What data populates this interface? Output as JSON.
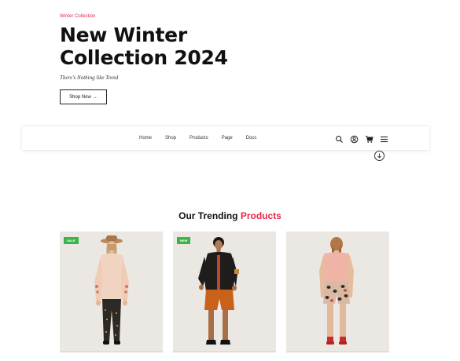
{
  "hero": {
    "eyebrow": "Winter Collection",
    "title_line1": "New Winter",
    "title_line2": "Collection 2024",
    "tagline": "There's Nothing like Trend",
    "cta_label": "Shop Now",
    "cta_arrow": "→"
  },
  "nav": {
    "links": [
      "Home",
      "Shop",
      "Products",
      "Page",
      "Docs"
    ],
    "icons": [
      "search-icon",
      "user-icon",
      "cart-icon",
      "menu-icon"
    ]
  },
  "section": {
    "title_prefix": "Our Trending",
    "title_accent": "Products"
  },
  "products": [
    {
      "badge": "SALE",
      "badge_color": "#3cb44a"
    },
    {
      "badge": "NEW",
      "badge_color": "#3cb44a"
    },
    {
      "badge": "",
      "badge_color": ""
    }
  ],
  "colors": {
    "accent": "#e8274b",
    "badge": "#3cb44a",
    "card_bg": "#ebe8e4"
  }
}
